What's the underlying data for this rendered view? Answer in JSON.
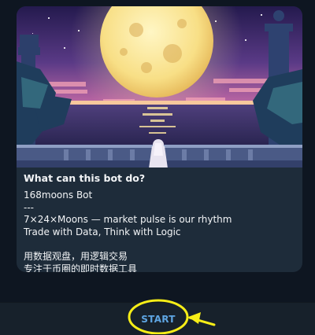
{
  "bot_card": {
    "title": "What can this bot do?",
    "lines": [
      "168moons Bot",
      "---",
      "7×24×Moons — market pulse is our rhythm",
      "Trade with Data, Think with Logic",
      "",
      "用数据观盘，用逻辑交易",
      "专注于币圈的即时数据工具"
    ]
  },
  "bottom_bar": {
    "start_label": "START"
  },
  "colors": {
    "app_background": "#0e1621",
    "card_background": "#1e2c3a",
    "bottom_bar_background": "#17212b",
    "accent_blue": "#5ea5e2",
    "highlight_yellow": "#f7ee17"
  }
}
